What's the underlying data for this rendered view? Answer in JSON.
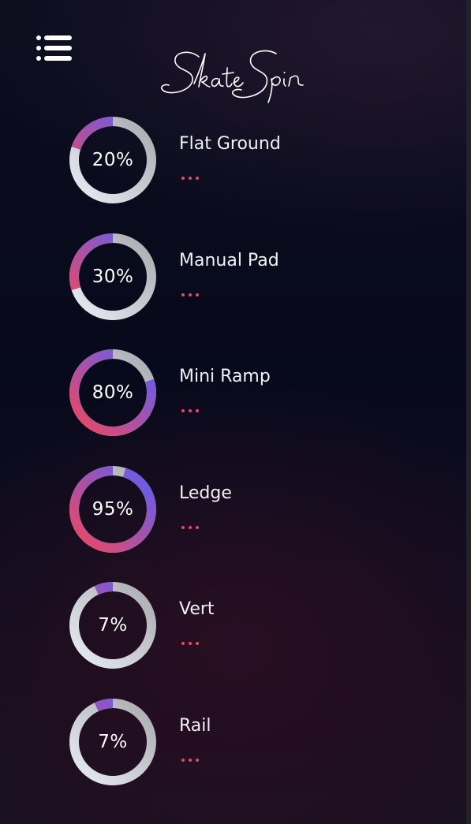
{
  "header": {
    "app_title": "Skate Spin",
    "menu_icon": "list-menu-icon"
  },
  "colors": {
    "track": "#a9aaae",
    "track_light": "#e8edf5",
    "accent_start": "#f0475e",
    "accent_end": "#5b5ff5",
    "more_dots": "#f0475e"
  },
  "progress_list": [
    {
      "percent": 20,
      "label": "20%",
      "name": "Flat Ground",
      "more_icon": "more-dots-icon"
    },
    {
      "percent": 30,
      "label": "30%",
      "name": "Manual Pad",
      "more_icon": "more-dots-icon"
    },
    {
      "percent": 80,
      "label": "80%",
      "name": "Mini Ramp",
      "more_icon": "more-dots-icon"
    },
    {
      "percent": 95,
      "label": "95%",
      "name": "Ledge",
      "more_icon": "more-dots-icon"
    },
    {
      "percent": 7,
      "label": "7%",
      "name": "Vert",
      "more_icon": "more-dots-icon"
    },
    {
      "percent": 7,
      "label": "7%",
      "name": "Rail",
      "more_icon": "more-dots-icon"
    }
  ]
}
